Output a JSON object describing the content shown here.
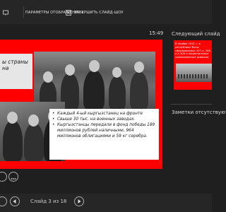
{
  "toolbar": {
    "display_settings_label": "ПАРАМЕТРЫ ОТОБРАЖЕНИЯ ▾",
    "end_show_label": "ЗАВЕРШИТЬ СЛАЙД-ШОУ",
    "icons": [
      "monitor-icon",
      "end-show-icon"
    ]
  },
  "clock": "15:49",
  "slide": {
    "top_box_text": "ы страны на",
    "bullets": [
      "Каждый 4-ый кыргызстанец на фронте",
      "Свыше 30 тыс. на военных заводах.",
      "Кыргызстанцы передали в фонд победы 189 миллионов рублей наличными, 964 миллионов облигациями и 59 кг серебра."
    ]
  },
  "right_panel": {
    "next_slide_label": "Следующий слайд",
    "thumb_text": "В ноябре 1941 г. в республике было сформировано 107-я, 306-я и 309-я национальные кавалерийские дивизии,",
    "notes_label": "Заметки отсутствуют"
  },
  "bottom_bar": {
    "slide_counter": "Слайд 3 из 18",
    "prev_icon": "prev-arrow-icon",
    "next_icon": "next-arrow-icon"
  },
  "colors": {
    "slide_bg": "#ff0000",
    "chrome": "#262626",
    "panel": "#1f1f1f"
  }
}
